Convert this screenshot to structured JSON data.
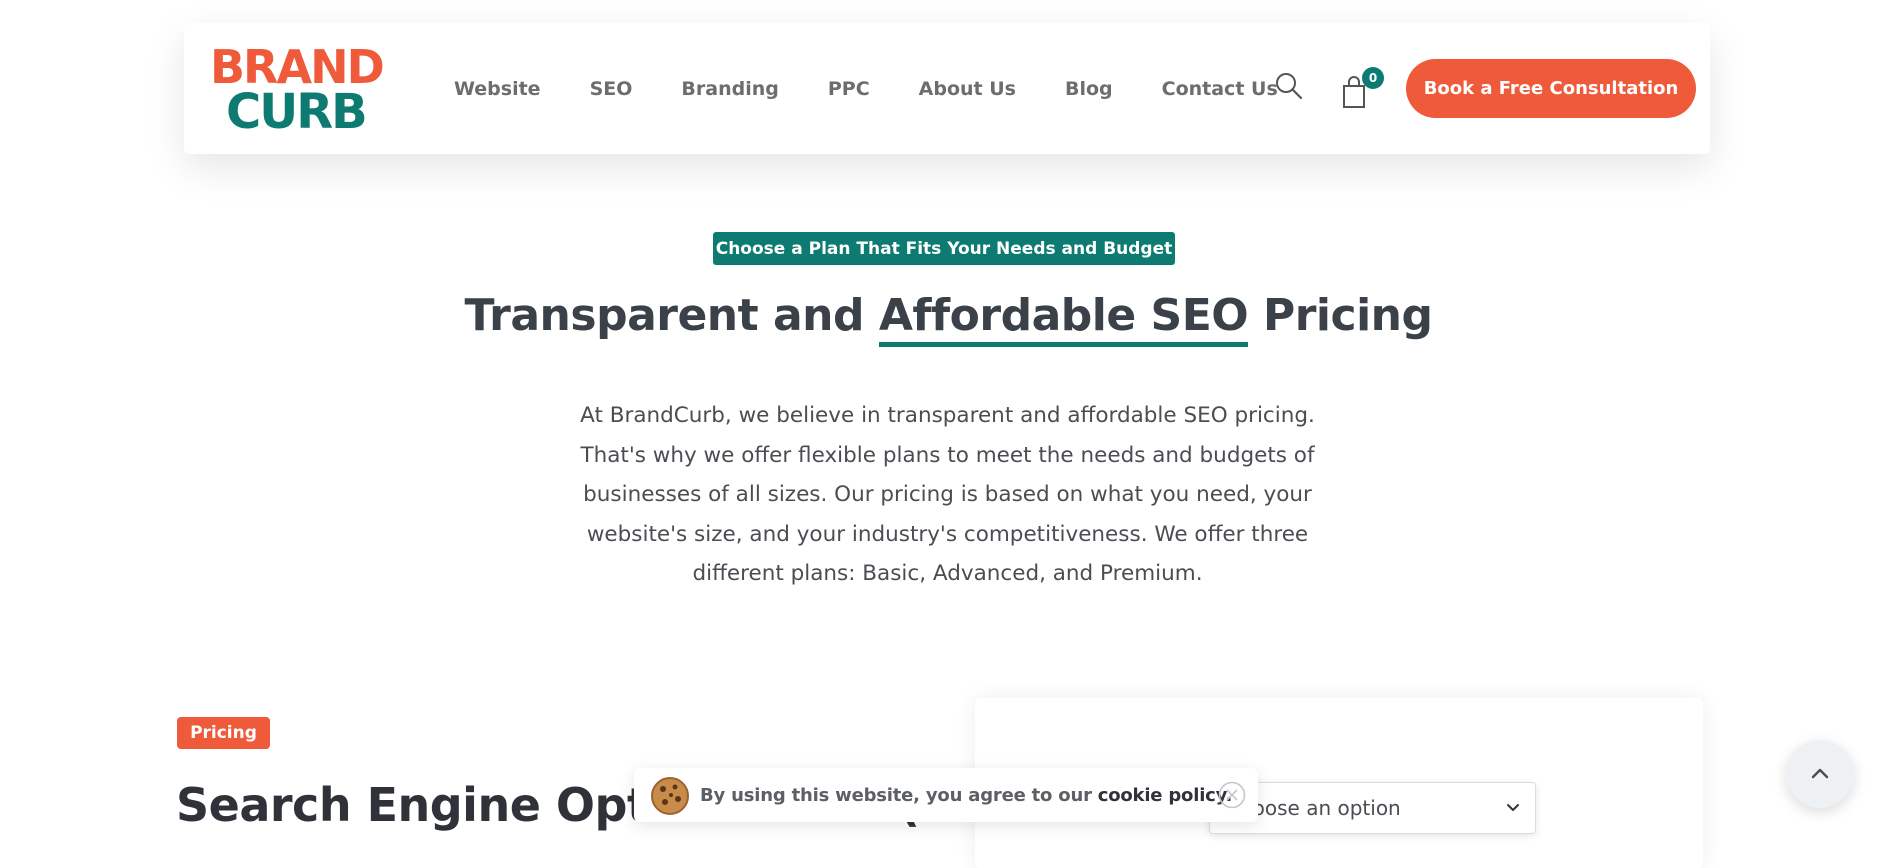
{
  "header": {
    "logo": {
      "line1": "BRAND",
      "line2": "CURB"
    },
    "nav": [
      "Website",
      "SEO",
      "Branding",
      "PPC",
      "About Us",
      "Blog",
      "Contact Us"
    ],
    "search_icon": "search-icon",
    "cart": {
      "icon": "shopping-bag-icon",
      "count": "0"
    },
    "cta_label": "Book a Free Consultation"
  },
  "hero": {
    "eyebrow": "Choose a Plan That Fits Your Needs and Budget",
    "title_before": "Transparent and ",
    "title_highlight": "Affordable SEO",
    "title_after": " Pricing",
    "description": "At BrandCurb, we believe in transparent and affordable SEO pricing. That's why we offer flexible plans to meet the needs and budgets of businesses of all sizes. Our pricing is based on what you need, your website's size, and your industry's competitiveness. We offer three different plans: Basic, Advanced, and Premium."
  },
  "pricing": {
    "badge": "Pricing",
    "title": "Search Engine Optimization (SEO)",
    "select_value": "Choose an option"
  },
  "cookie": {
    "text": "By using this website, you agree to our",
    "link": "cookie policy."
  },
  "colors": {
    "primary": "#ef5a3b",
    "secondary": "#0e7b72",
    "heading": "#3b4149"
  },
  "icons": {
    "back_to_top": "chevron-up-icon",
    "cookie": "cookie-icon",
    "close": "close-icon"
  }
}
